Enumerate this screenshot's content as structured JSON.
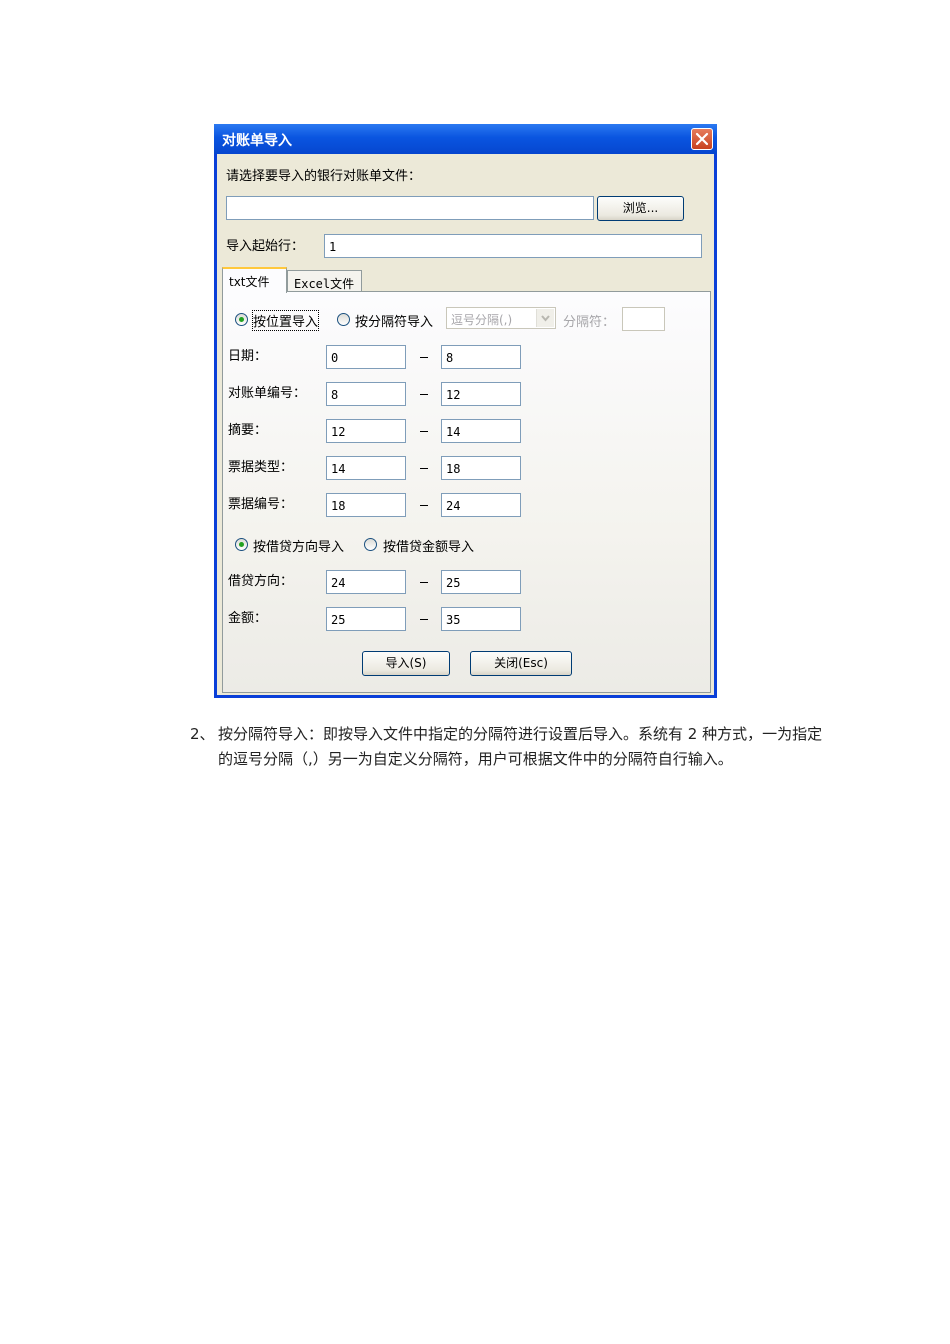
{
  "dialog": {
    "title": "对账单导入",
    "select_prompt": "请选择要导入的银行对账单文件：",
    "file_path_value": "",
    "browse_label": "浏览...",
    "start_row_label": "导入起始行：",
    "start_row_value": "1",
    "tabs": [
      {
        "label": "txt文件",
        "active": true
      },
      {
        "label": "Excel文件",
        "active": false
      }
    ],
    "import_mode": {
      "by_position_label": "按位置导入",
      "by_position_selected": true,
      "by_separator_label": "按分隔符导入",
      "by_separator_selected": false,
      "separator_combo_value": "逗号分隔(,)",
      "separator_label": "分隔符：",
      "separator_value": ""
    },
    "position_rows": [
      {
        "label": "日期：",
        "from": "0",
        "to": "8"
      },
      {
        "label": "对账单编号：",
        "from": "8",
        "to": "12"
      },
      {
        "label": "摘要：",
        "from": "12",
        "to": "14"
      },
      {
        "label": "票据类型：",
        "from": "14",
        "to": "18"
      },
      {
        "label": "票据编号：",
        "from": "18",
        "to": "24"
      }
    ],
    "amount_mode": {
      "by_direction_label": "按借贷方向导入",
      "by_direction_selected": true,
      "by_amount_label": "按借贷金额导入",
      "by_amount_selected": false
    },
    "amount_rows": [
      {
        "label": "借贷方向：",
        "from": "24",
        "to": "25"
      },
      {
        "label": "金额：",
        "from": "25",
        "to": "35"
      }
    ],
    "import_button": "导入(S)",
    "close_button": "关闭(Esc)"
  },
  "document": {
    "item_number": "2、",
    "paragraph": "按分隔符导入：即按导入文件中指定的分隔符进行设置后导入。系统有 2 种方式，一为指定的逗号分隔（,）另一为自定义分隔符，用户可根据文件中的分隔符自行输入。"
  },
  "colors": {
    "titlebar_blue": "#0a55e0",
    "dialog_bg": "#ece9d8",
    "close_red": "#c8401e",
    "radio_green": "#21a121"
  }
}
